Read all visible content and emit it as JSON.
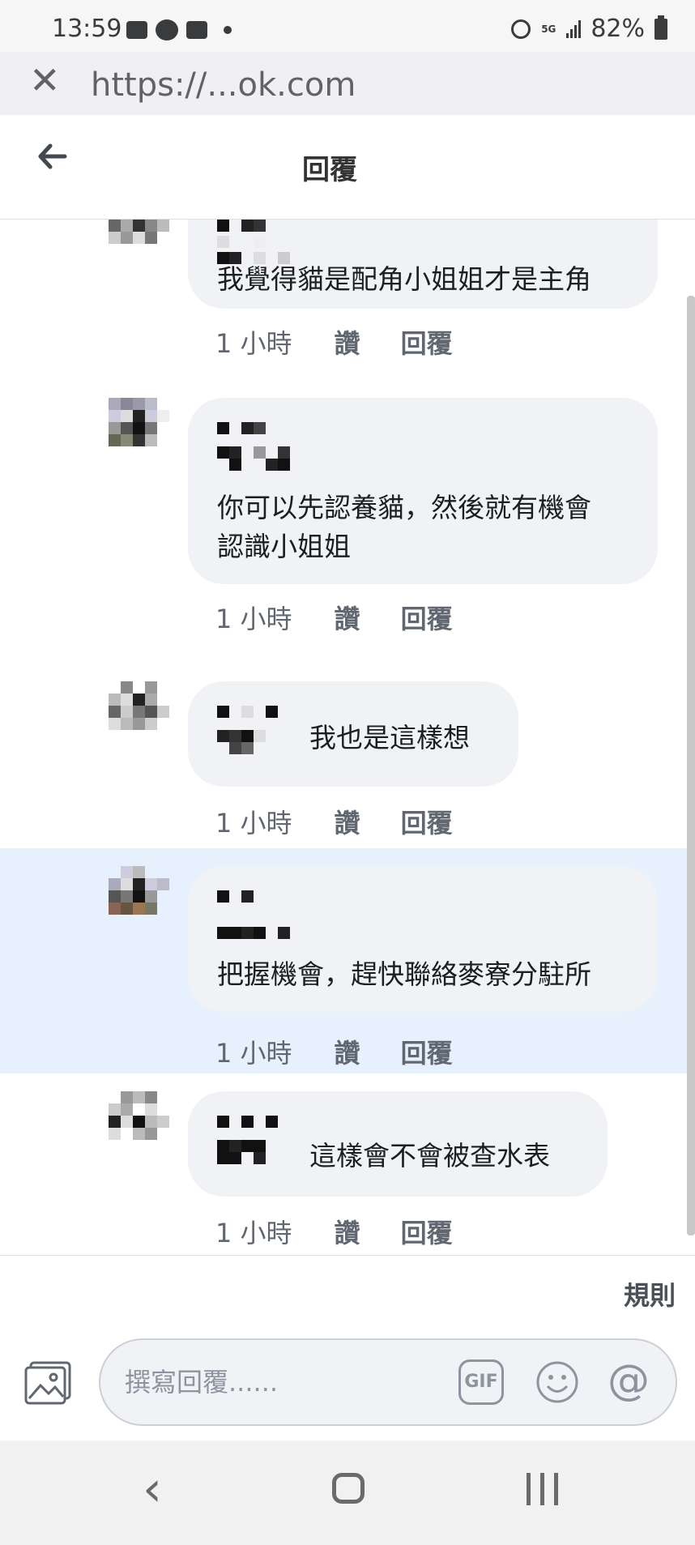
{
  "status_bar": {
    "time": "13:59",
    "network": "5G",
    "battery": "82%"
  },
  "browser": {
    "close_glyph": "✕",
    "url": "https://...ok.com"
  },
  "header": {
    "title": "回覆",
    "back_icon": "arrow-left-icon"
  },
  "comments": [
    {
      "text": "我覺得貓是配角小姐姐才是主角",
      "time": "1 小時",
      "like_label": "讚",
      "reply_label": "回覆",
      "highlighted": false
    },
    {
      "text": "你可以先認養貓，然後就有機會\n認識小姐姐",
      "time": "1 小時",
      "like_label": "讚",
      "reply_label": "回覆",
      "highlighted": false
    },
    {
      "text": "我也是這樣想",
      "time": "1 小時",
      "like_label": "讚",
      "reply_label": "回覆",
      "highlighted": false
    },
    {
      "text": "把握機會，趕快聯絡麥寮分駐所",
      "time": "1 小時",
      "like_label": "讚",
      "reply_label": "回覆",
      "highlighted": true
    },
    {
      "text": "這樣會不會被查水表",
      "time": "1 小時",
      "like_label": "讚",
      "reply_label": "回覆",
      "highlighted": false
    }
  ],
  "footer": {
    "rules_label": "規則"
  },
  "composer": {
    "placeholder": "撰寫回覆......",
    "gif_label": "GIF",
    "at_label": "@",
    "icons": [
      "photo-icon",
      "gif-icon",
      "emoji-icon",
      "at-icon"
    ]
  },
  "nav": {
    "back_glyph": "‹"
  },
  "colors": {
    "bubble": "#f0f2f5",
    "highlight": "#e7f0fd",
    "meta_text": "#606770"
  }
}
